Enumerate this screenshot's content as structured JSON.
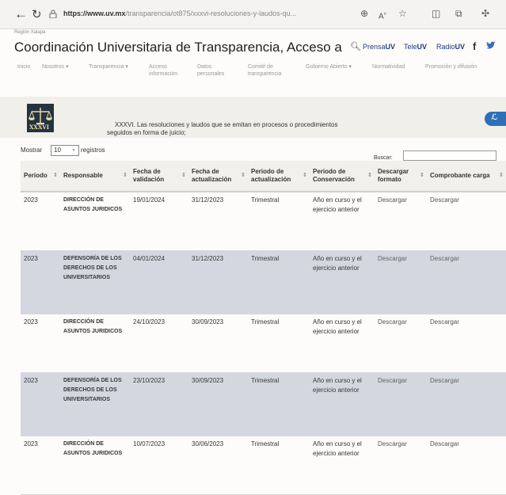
{
  "browser": {
    "url_host": "https://www.uv.mx",
    "url_path": "/transparencia/ot875/xxxvi-resoluciones-y-laudos-qu...",
    "icons": [
      "back-arrow-icon",
      "reload-icon",
      "lock-icon",
      "zoom-icon",
      "read-aloud-icon",
      "favorite-star-icon",
      "split-screen-icon",
      "collections-icon",
      "extensions-icon"
    ]
  },
  "header": {
    "region": "Región Xalapa",
    "title": "Coordinación Universitaria de Transparencia, Acceso a la I...",
    "media": [
      {
        "bold": "Prensa",
        "rest": "UV"
      },
      {
        "bold": "Tele",
        "rest": "UV"
      },
      {
        "bold": "Radio",
        "rest": "UV"
      }
    ],
    "social_f": "f"
  },
  "nav": [
    {
      "label": "Inicio"
    },
    {
      "label": "Nosotros ▾"
    },
    {
      "label": "Transparencia ▾"
    },
    {
      "label": "Acceso",
      "label2": "información"
    },
    {
      "label": "Datos",
      "label2": "personales"
    },
    {
      "label": "Comité de",
      "label2": "transparencia"
    },
    {
      "label": "Gobierno Abierto ▾"
    },
    {
      "label": "Normatividad"
    },
    {
      "label": "Promoción y difusión"
    }
  ],
  "intro": {
    "logo_text": "XXXVI",
    "line1": "XXXVI. Las resoluciones y laudos que se emitan en procesos o procedimientos",
    "line2": "seguidos en forma de juicio;"
  },
  "controls": {
    "show_label": "Mostrar",
    "length_value": "10",
    "records_label": "registros",
    "search_label": "Buscar:",
    "search_value": ""
  },
  "table": {
    "columns": [
      "Periodo",
      "Responsable",
      "Fecha de validación",
      "Fecha de actualización",
      "Periodo de actualización",
      "Periodo de Conservación",
      "Descargar formato",
      "Comprobante carga"
    ],
    "rows": [
      [
        "2023",
        "DIRECCIÓN DE ASUNTOS JURIDICOS",
        "19/01/2024",
        "31/12/2023",
        "Trimestral",
        "Año en curso y el ejercicio anterior",
        "Descargar",
        "Descargar"
      ],
      [
        "2023",
        "DEFENSORÍA DE LOS DERECHOS DE LOS UNIVERSITARIOS",
        "04/01/2024",
        "31/12/2023",
        "Trimestral",
        "Año en curso y el ejercicio anterior",
        "Descargar",
        "Descargar"
      ],
      [
        "2023",
        "DIRECCIÓN DE ASUNTOS JURIDICOS",
        "24/10/2023",
        "30/09/2023",
        "Trimestral",
        "Año en curso y el ejercicio anterior",
        "Descargar",
        "Descargar"
      ],
      [
        "2023",
        "DEFENSORÍA DE LOS DERECHOS DE LOS UNIVERSITARIOS",
        "23/10/2023",
        "30/09/2023",
        "Trimestral",
        "Año en curso y el ejercicio anterior",
        "Descargar",
        "Descargar"
      ],
      [
        "2023",
        "DIRECCIÓN DE ASUNTOS JURIDICOS",
        "10/07/2023",
        "30/06/2023",
        "Trimestral",
        "Año en curso y el ejercicio anterior",
        "Descargar",
        "Descargar"
      ]
    ]
  },
  "colors": {
    "brand_blue": "#223a7c",
    "stripe": "#d4d6e0",
    "logo_bg": "#24333f"
  }
}
